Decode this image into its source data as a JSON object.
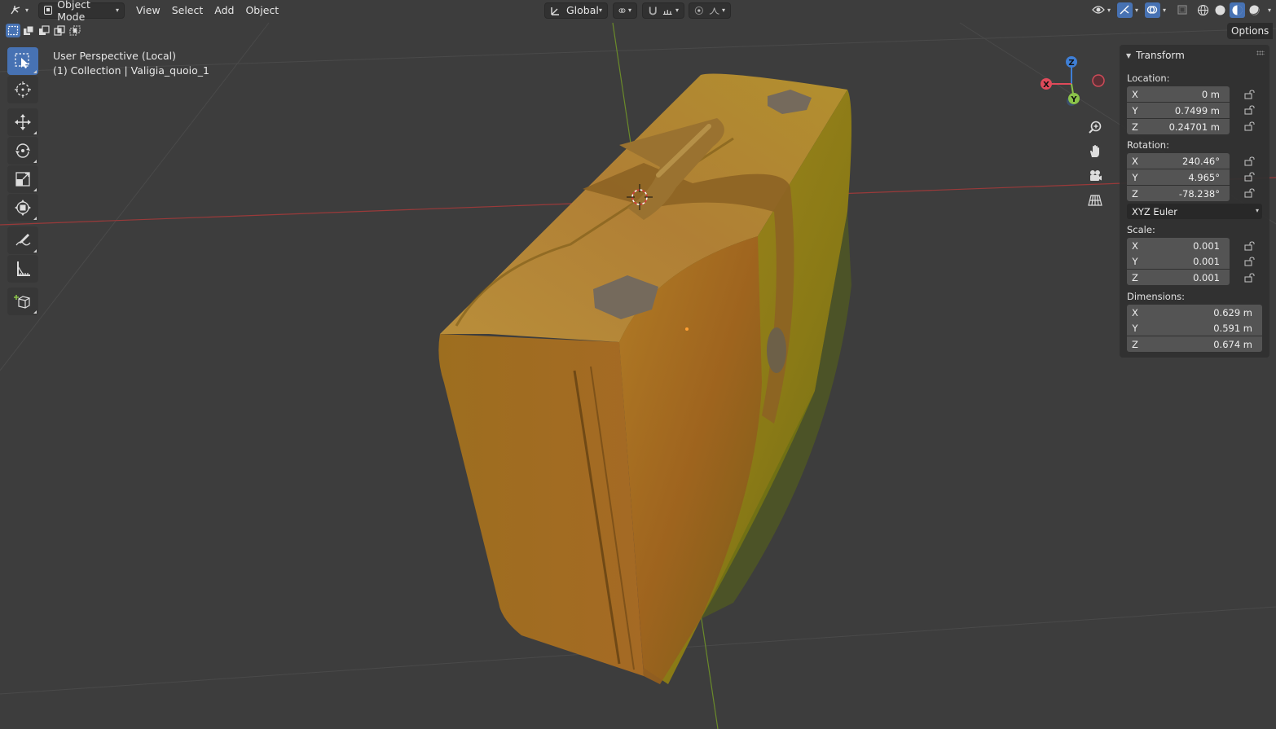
{
  "header": {
    "editor_icon": "view3d-icon",
    "mode_label": "Object Mode",
    "menus": [
      "View",
      "Select",
      "Add",
      "Object"
    ],
    "orientation_label": "Global",
    "options_label": "Options"
  },
  "viewport_info": {
    "line1": "User Perspective (Local)",
    "line2": "(1) Collection | Valigia_quoio_1"
  },
  "gizmo": {
    "x_label": "X",
    "y_label": "Y",
    "z_label": "Z"
  },
  "toolbar": {
    "tools": [
      "select-box",
      "cursor",
      "move",
      "rotate",
      "scale",
      "transform",
      "annotate",
      "measure",
      "add-cube"
    ],
    "active_tool": "select-box"
  },
  "transform": {
    "title": "Transform",
    "location_label": "Location:",
    "location": {
      "x": "0 m",
      "y": "0.7499 m",
      "z": "0.24701 m"
    },
    "rotation_label": "Rotation:",
    "rotation": {
      "x": "240.46°",
      "y": "4.965°",
      "z": "-78.238°"
    },
    "rotation_mode": "XYZ Euler",
    "scale_label": "Scale:",
    "scale": {
      "x": "0.001",
      "y": "0.001",
      "z": "0.001"
    },
    "dimensions_label": "Dimensions:",
    "dimensions": {
      "x": "0.629 m",
      "y": "0.591 m",
      "z": "0.674 m"
    },
    "axis_x": "X",
    "axis_y": "Y",
    "axis_z": "Z"
  },
  "colors": {
    "accent": "#4772b3",
    "x_axis": "#e04a5a",
    "y_axis": "#8bc34a",
    "z_axis": "#3f7fd6",
    "viewport_bg": "#3d3d3d"
  }
}
